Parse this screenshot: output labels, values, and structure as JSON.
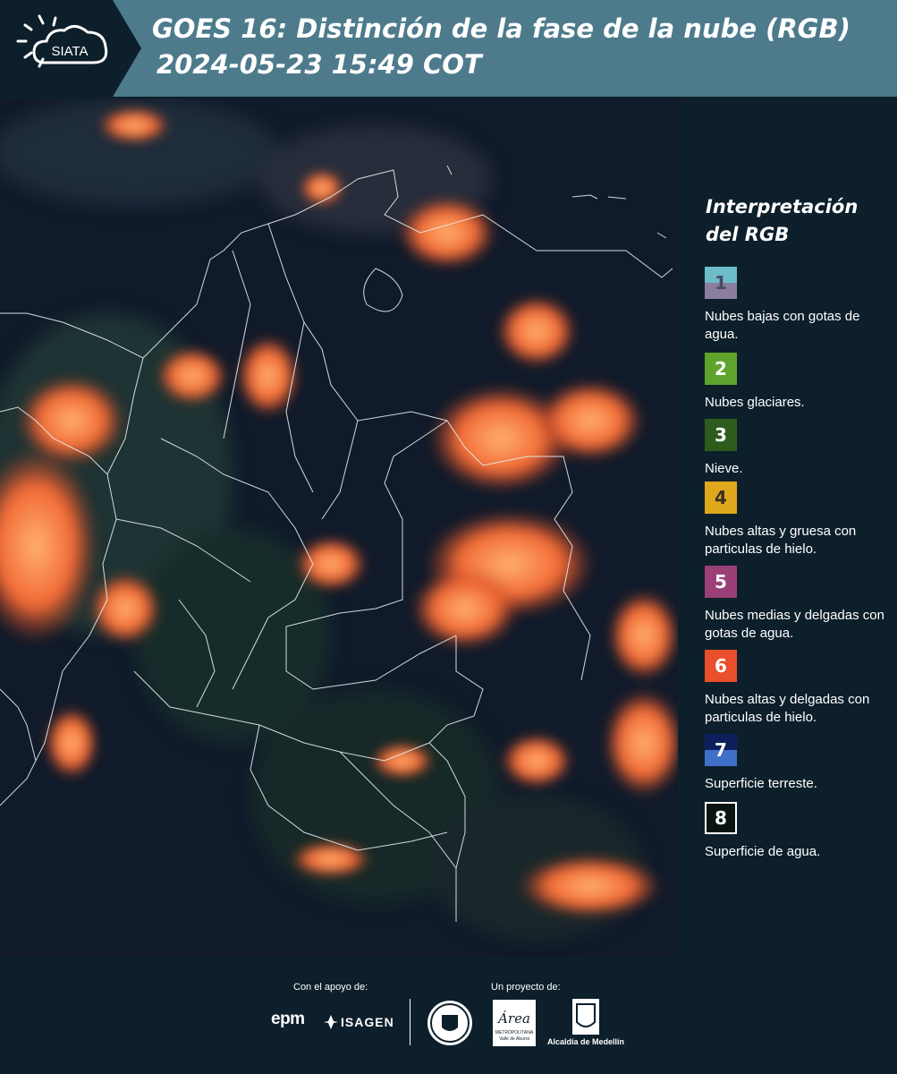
{
  "header": {
    "logo_text": "SIATA",
    "title": "GOES 16: Distinción de la fase de la nube (RGB)",
    "subtitle": "2024-05-23 15:49 COT"
  },
  "legend": {
    "title": "Interpretación del RGB",
    "items": [
      {
        "num": "1",
        "label": "Nubes bajas con gotas de agua.",
        "color_top": "#6cbcc9",
        "color_bottom": "#8a7d9e",
        "num_color": "#4a4a60"
      },
      {
        "num": "2",
        "label": "Nubes glaciares.",
        "color_top": "#5fa32c",
        "color_bottom": "#5fa32c",
        "num_color": "#ffffff"
      },
      {
        "num": "3",
        "label": "Nieve.",
        "color_top": "#2e5c1c",
        "color_bottom": "#2e5c1c",
        "num_color": "#ffffff"
      },
      {
        "num": "4",
        "label": "Nubes altas y gruesa con particulas de hielo.",
        "color_top": "#e0a81c",
        "color_bottom": "#e0a81c",
        "num_color": "#3a3020"
      },
      {
        "num": "5",
        "label": "Nubes medias y delgadas con gotas de agua.",
        "color_top": "#9a3f78",
        "color_bottom": "#9a3f78",
        "num_color": "#ffffff"
      },
      {
        "num": "6",
        "label": "Nubes altas y delgadas con particulas de hielo.",
        "color_top": "#ea4f2b",
        "color_bottom": "#ea4f2b",
        "num_color": "#ffffff"
      },
      {
        "num": "7",
        "label": "Superficie terreste.",
        "color_top": "#0c1f5c",
        "color_bottom": "#3f6fc7",
        "num_color": "#ffffff"
      },
      {
        "num": "8",
        "label": "Superficie de agua.",
        "color_top": "#0a1510",
        "color_bottom": "#0a1510",
        "num_color": "#ffffff"
      }
    ]
  },
  "footer": {
    "support_label": "Con el apoyo de:",
    "project_label": "Un proyecto de:",
    "sponsor1": "epm",
    "sponsor2": "ISAGEN",
    "partner_area": "Área",
    "partner_area_sub": "METROPOLITANA",
    "partner_area_sub2": "Valle de Aburrá",
    "partner_alcaldia": "Alcaldía de Medellín"
  },
  "colors": {
    "header_bg": "#4d7b8c",
    "panel_bg": "#0d1f2b",
    "cloud_orange": "#f2703a"
  }
}
